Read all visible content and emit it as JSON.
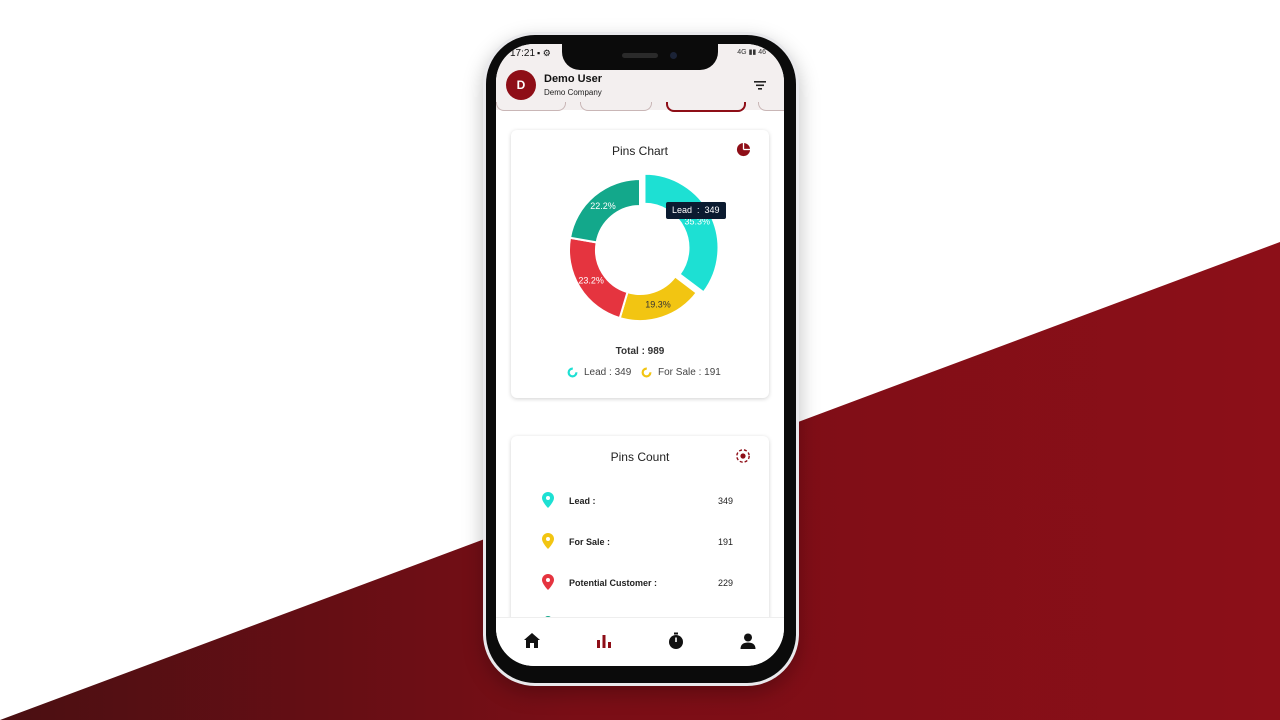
{
  "status": {
    "time": "17:21",
    "icons_left": "▪ ⚙",
    "icons_right": "4G ▮▮ 46"
  },
  "header": {
    "avatar_letter": "D",
    "user_name": "Demo User",
    "company": "Demo Company",
    "filter_icon": "filter-icon"
  },
  "pins_chart": {
    "title": "Pins Chart",
    "total_label": "Total : 989",
    "tooltip": "Lead  :  349",
    "legend": [
      {
        "label": "Lead : 349",
        "color": "#1de0d3"
      },
      {
        "label": "For Sale : 191",
        "color": "#f2c512"
      }
    ]
  },
  "chart_data": {
    "type": "pie",
    "variant": "donut",
    "total": 989,
    "slices": [
      {
        "name": "Lead",
        "value": 349,
        "label": "35.3%",
        "color": "#1de0d3"
      },
      {
        "name": "For Sale",
        "value": 191,
        "label": "19.3%",
        "color": "#f2c512"
      },
      {
        "name": "Potential Customer",
        "value": 229,
        "label": "23.2%",
        "color": "#e5343f"
      },
      {
        "name": "",
        "value": 220,
        "label": "22.2%",
        "color": "#13a88b"
      }
    ]
  },
  "pins_count": {
    "title": "Pins Count",
    "rows": [
      {
        "label": "Lead :",
        "value": "349",
        "color": "#1de0d3"
      },
      {
        "label": "For Sale :",
        "value": "191",
        "color": "#f2c512"
      },
      {
        "label": "Potential Customer :",
        "value": "229",
        "color": "#e5343f"
      }
    ]
  },
  "nav": {
    "items": [
      "home-icon",
      "bar-chart-icon",
      "stopwatch-icon",
      "profile-icon"
    ],
    "active": "bar-chart-icon",
    "active_color": "#8e0e17"
  },
  "colors": {
    "brand": "#8e0e17"
  }
}
